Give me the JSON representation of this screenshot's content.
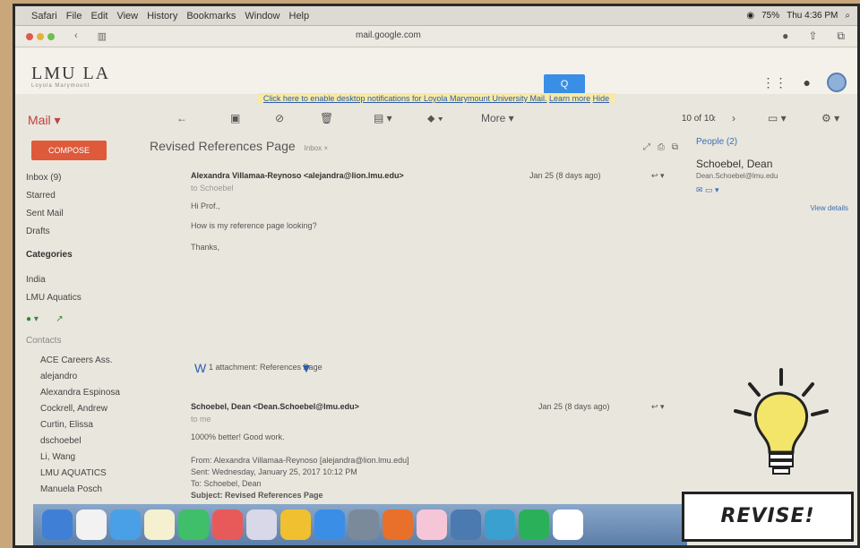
{
  "menubar": {
    "items": [
      "Safari",
      "File",
      "Edit",
      "View",
      "History",
      "Bookmarks",
      "Window",
      "Help"
    ],
    "battery": "75%",
    "clock": "Thu 4:36 PM"
  },
  "browser": {
    "url": "mail.google.com"
  },
  "header": {
    "logo": "LMU LA",
    "logo_sub": "Loyola Marymount",
    "search_icon": "Q"
  },
  "notification": {
    "text": "Click here to enable desktop notifications for Loyola Marymount University Mail.",
    "learn_more": "Learn more",
    "hide": "Hide"
  },
  "toolbar": {
    "mail_label": "Mail ▾",
    "more_label": "More ▾",
    "pager": "10 of 10"
  },
  "sidebar": {
    "compose": "COMPOSE",
    "items": [
      "Inbox (9)",
      "Starred",
      "Sent Mail",
      "Drafts"
    ],
    "categories_heading": "Categories",
    "labels": [
      "India",
      "LMU Aquatics"
    ],
    "contacts_heading": "Contacts",
    "contacts": [
      "ACE Careers Ass.",
      "alejandro",
      "Alexandra Espinosa",
      "Cockrell, Andrew",
      "Curtin, Elissa",
      "dschoebel",
      "Li, Wang",
      "LMU AQUATICS",
      "Manuela Posch"
    ]
  },
  "thread": {
    "subject": "Revised References Page",
    "subject_tag": "Inbox ×",
    "messages": [
      {
        "sender": "Alexandra Villamaa-Reynoso <alejandra@lion.lmu.edu>",
        "to": "to Schoebel",
        "date": "Jan 25 (8 days ago)",
        "lines": [
          "Hi Prof.,",
          "How is my reference page looking?",
          "Thanks,"
        ]
      },
      {
        "sender": "Schoebel, Dean <Dean.Schoebel@lmu.edu>",
        "to": "to me",
        "date": "Jan 25 (8 days ago)",
        "lines": [
          "1000% better! Good work.",
          "From: Alexandra Villamaa-Reynoso [alejandra@lion.lmu.edu]",
          "Sent: Wednesday, January 25, 2017 10:12 PM",
          "To: Schoebel, Dean",
          "Subject: Revised References Page"
        ]
      }
    ],
    "attachment": "1 attachment: References Page"
  },
  "people": {
    "title": "People (2)",
    "name": "Schoebel, Dean",
    "email": "Dean.Schoebel@lmu.edu",
    "view": "View details"
  },
  "overlay": {
    "caption": "REVISE!"
  }
}
